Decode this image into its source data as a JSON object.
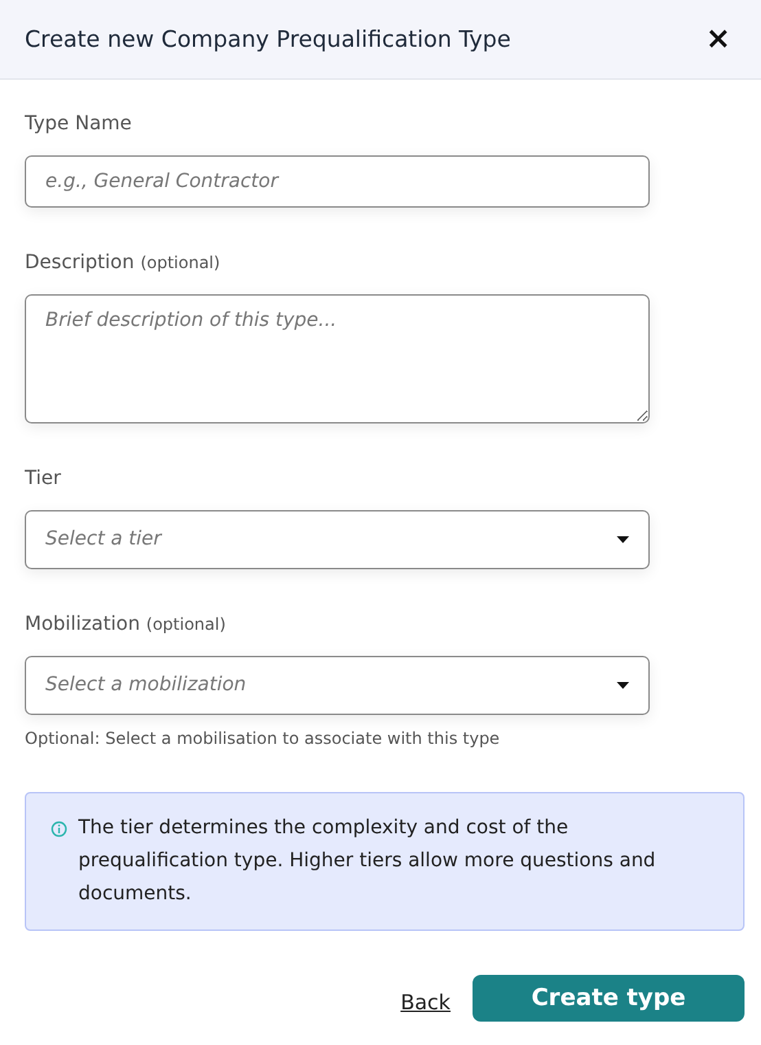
{
  "modal": {
    "title": "Create new Company Prequalification Type",
    "close_label": "×"
  },
  "fields": [
    {
      "kind": "text",
      "label": "Type Name",
      "placeholder": "e.g., General Contractor"
    },
    {
      "kind": "textarea",
      "label": "Description",
      "label_suffix": "(optional)",
      "placeholder": "Brief description of this type..."
    },
    {
      "kind": "select",
      "label": "Tier",
      "placeholder": "Select a tier"
    },
    {
      "kind": "select",
      "label": "Mobilization",
      "label_suffix": "(optional)",
      "placeholder": "Select a mobilization",
      "help": "Optional: Select a mobilisation to associate with this type"
    }
  ],
  "info": {
    "text": "The tier determines the complexity and cost of the prequalification type. Higher tiers allow more questions and documents."
  },
  "buttons": {
    "back": "Back",
    "submit": "Create type"
  }
}
